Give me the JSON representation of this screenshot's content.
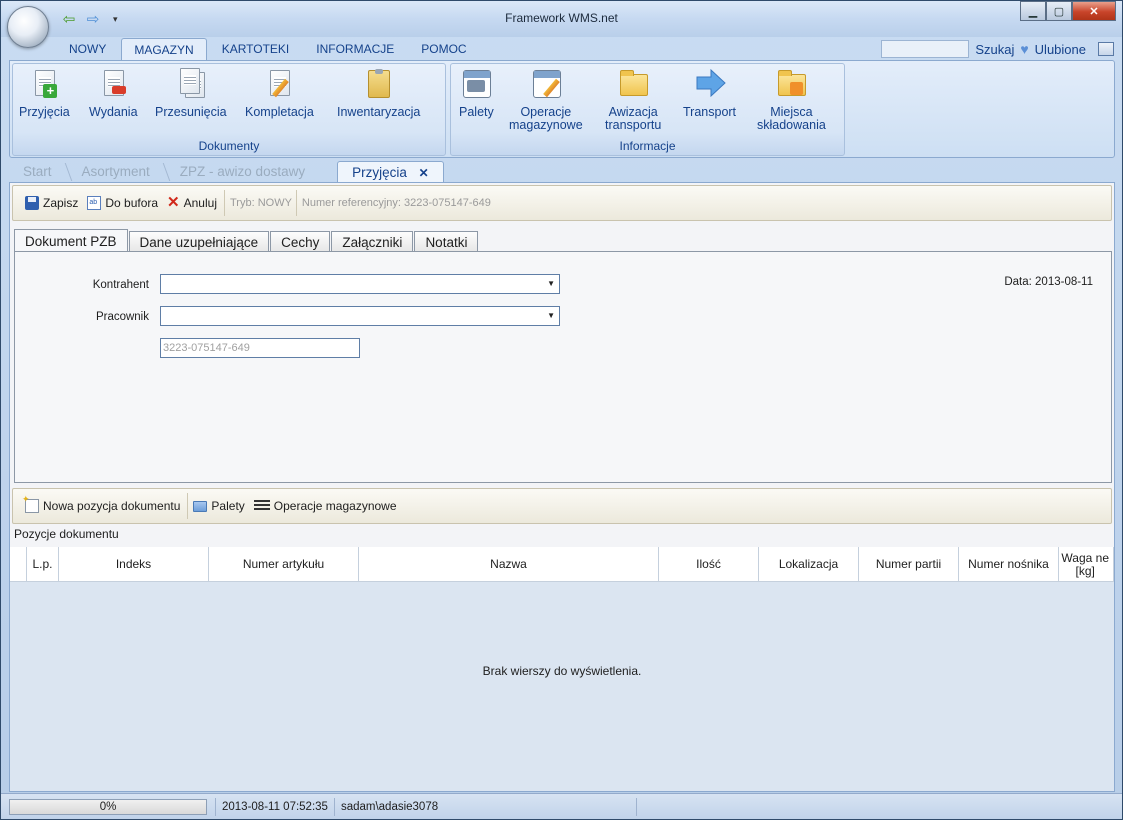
{
  "window": {
    "title": "Framework WMS.net"
  },
  "ribbon": {
    "tabs": [
      {
        "label": "NOWY",
        "active": false
      },
      {
        "label": "MAGAZYN",
        "active": true
      },
      {
        "label": "KARTOTEKI",
        "active": false
      },
      {
        "label": "INFORMACJE",
        "active": false
      },
      {
        "label": "POMOC",
        "active": false
      }
    ],
    "search_label": "Szukaj",
    "favorites_label": "Ulubione",
    "groups": [
      {
        "label": "Dokumenty",
        "buttons": [
          {
            "label": "Przyjęcia",
            "icon": "doc-add-icon"
          },
          {
            "label": "Wydania",
            "icon": "doc-remove-icon"
          },
          {
            "label": "Przesunięcia",
            "icon": "docs-icon"
          },
          {
            "label": "Kompletacja",
            "icon": "doc-edit-icon"
          },
          {
            "label": "Inwentaryzacja",
            "icon": "clipboard-icon"
          }
        ]
      },
      {
        "label": "Informacje",
        "buttons": [
          {
            "label": "Palety",
            "icon": "pallet-calendar-icon"
          },
          {
            "label": "Operacje\nmagazynowe",
            "icon": "calendar-edit-icon"
          },
          {
            "label": "Awizacja\ntransportu",
            "icon": "folder-icon"
          },
          {
            "label": "Transport",
            "icon": "arrow-right-icon"
          },
          {
            "label": "Miejsca\nskładowania",
            "icon": "folder-rss-icon"
          }
        ]
      }
    ]
  },
  "doc_tabs": [
    {
      "label": "Start",
      "active": false
    },
    {
      "label": "Asortyment",
      "active": false
    },
    {
      "label": "ZPZ - awizo dostawy",
      "active": false
    },
    {
      "label": "Przyjęcia",
      "active": true,
      "close": "✕"
    }
  ],
  "toolbar": {
    "save": "Zapisz",
    "copy": "Do bufora",
    "cancel": "Anuluj",
    "mode": "Tryb: NOWY",
    "ref": "Numer referencyjny: 3223-075147-649"
  },
  "sub_tabs": [
    {
      "label": "Dokument PZB",
      "active": true
    },
    {
      "label": "Dane uzupełniające",
      "active": false
    },
    {
      "label": "Cechy",
      "active": false
    },
    {
      "label": "Załączniki",
      "active": false
    },
    {
      "label": "Notatki",
      "active": false
    }
  ],
  "form": {
    "kontrahent_label": "Kontrahent",
    "kontrahent_value": "",
    "pracownik_label": "Pracownik",
    "pracownik_value": "",
    "ref_value": "3223-075147-649",
    "date": "Data: 2013-08-11"
  },
  "positions_toolbar": {
    "new": "Nowa pozycja dokumentu",
    "pallets": "Palety",
    "ops": "Operacje magazynowe"
  },
  "grid": {
    "caption": "Pozycje dokumentu",
    "columns": [
      "L.p.",
      "Indeks",
      "Numer artykułu",
      "Nazwa",
      "Ilość",
      "Lokalizacja",
      "Numer partii",
      "Numer nośnika",
      "Waga ne\n[kg]"
    ],
    "empty": "Brak wierszy do wyświetlenia."
  },
  "status": {
    "progress": "0%",
    "progress_value": 0,
    "datetime": "2013-08-11 07:52:35",
    "user": "sadam\\adasie3078"
  }
}
